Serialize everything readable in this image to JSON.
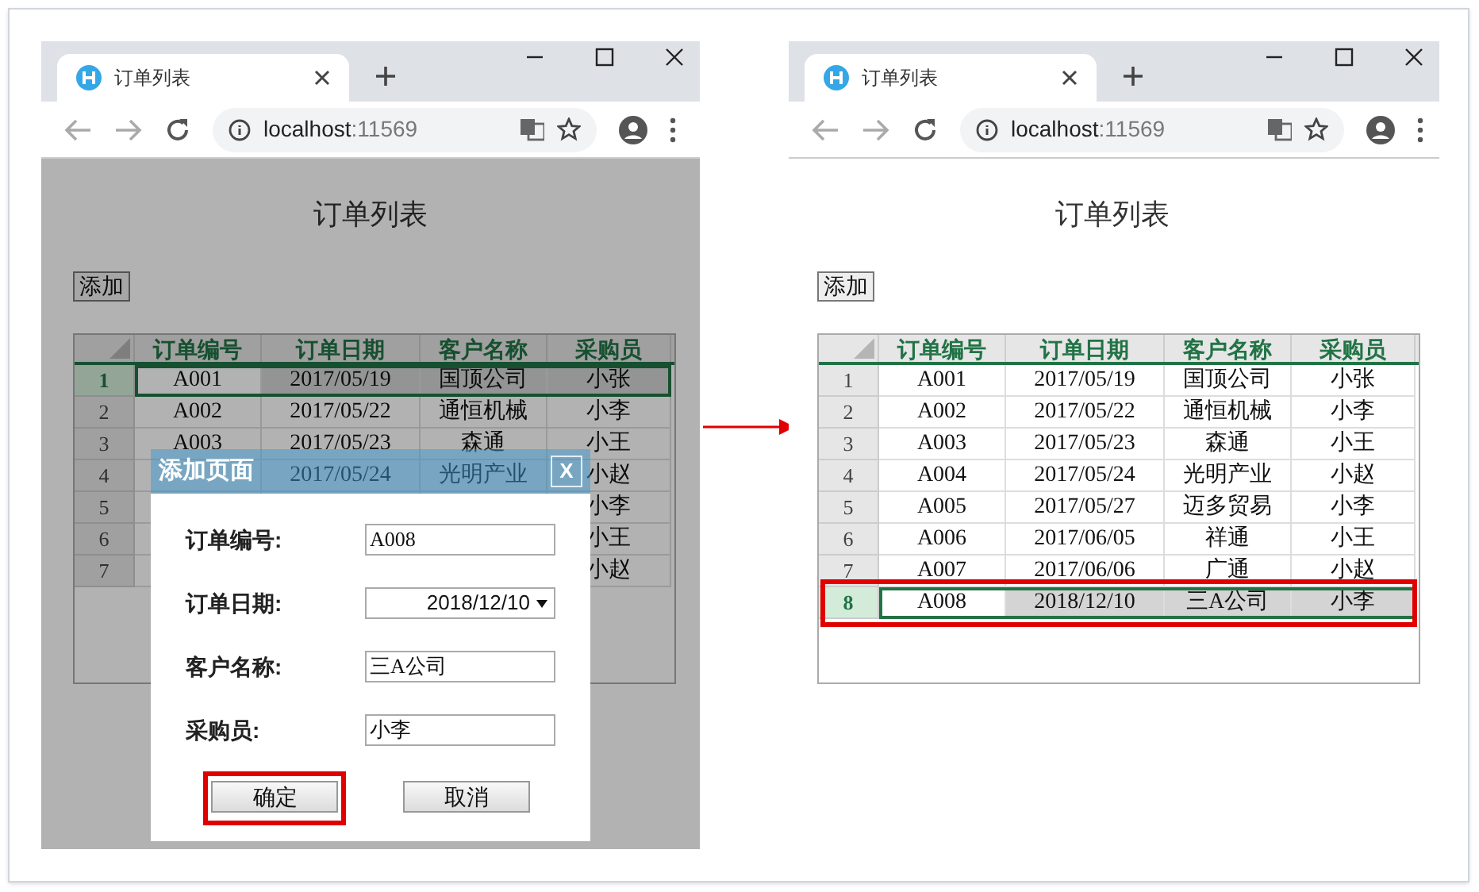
{
  "panels": [
    {
      "dimmed": true,
      "browser": {
        "tab_title": "订单列表",
        "host": "localhost",
        "port": ":11569"
      },
      "page": {
        "heading": "订单列表",
        "add_button": "添加",
        "table": {
          "columns": [
            "订单编号",
            "订单日期",
            "客户名称",
            "采购员"
          ],
          "rows": [
            {
              "number": "1",
              "selected": true,
              "annotated": false,
              "cells": [
                "A001",
                "2017/05/19",
                "国顶公司",
                "小张"
              ]
            },
            {
              "number": "2",
              "selected": false,
              "annotated": false,
              "cells": [
                "A002",
                "2017/05/22",
                "通恒机械",
                "小李"
              ]
            },
            {
              "number": "3",
              "selected": false,
              "annotated": false,
              "cells": [
                "A003",
                "2017/05/23",
                "森通",
                "小王"
              ]
            },
            {
              "number": "4",
              "selected": false,
              "annotated": false,
              "cells": [
                null,
                "2017/05/24",
                "光明产业",
                "小赵"
              ]
            },
            {
              "number": "5",
              "selected": false,
              "annotated": false,
              "cells": [
                null,
                null,
                null,
                "小李"
              ]
            },
            {
              "number": "6",
              "selected": false,
              "annotated": false,
              "cells": [
                null,
                null,
                null,
                "小王"
              ]
            },
            {
              "number": "7",
              "selected": false,
              "annotated": false,
              "cells": [
                null,
                null,
                null,
                "小赵"
              ]
            }
          ]
        }
      },
      "dialog": {
        "title": "添加页面",
        "close": "X",
        "fields": [
          {
            "kind": "text",
            "label": "订单编号:",
            "value": "A008"
          },
          {
            "kind": "select",
            "label": "订单日期:",
            "value": "2018/12/10"
          },
          {
            "kind": "text",
            "label": "客户名称:",
            "value": "三A公司"
          },
          {
            "kind": "text",
            "label": "采购员:",
            "value": "小李"
          }
        ],
        "buttons": [
          {
            "label": "确定",
            "annotated": true
          },
          {
            "label": "取消",
            "annotated": false
          }
        ]
      }
    },
    {
      "dimmed": false,
      "browser": {
        "tab_title": "订单列表",
        "host": "localhost",
        "port": ":11569"
      },
      "page": {
        "heading": "订单列表",
        "add_button": "添加",
        "table": {
          "columns": [
            "订单编号",
            "订单日期",
            "客户名称",
            "采购员"
          ],
          "rows": [
            {
              "number": "1",
              "selected": false,
              "annotated": false,
              "cells": [
                "A001",
                "2017/05/19",
                "国顶公司",
                "小张"
              ]
            },
            {
              "number": "2",
              "selected": false,
              "annotated": false,
              "cells": [
                "A002",
                "2017/05/22",
                "通恒机械",
                "小李"
              ]
            },
            {
              "number": "3",
              "selected": false,
              "annotated": false,
              "cells": [
                "A003",
                "2017/05/23",
                "森通",
                "小王"
              ]
            },
            {
              "number": "4",
              "selected": false,
              "annotated": false,
              "cells": [
                "A004",
                "2017/05/24",
                "光明产业",
                "小赵"
              ]
            },
            {
              "number": "5",
              "selected": false,
              "annotated": false,
              "cells": [
                "A005",
                "2017/05/27",
                "迈多贸易",
                "小李"
              ]
            },
            {
              "number": "6",
              "selected": false,
              "annotated": false,
              "cells": [
                "A006",
                "2017/06/05",
                "祥通",
                "小王"
              ]
            },
            {
              "number": "7",
              "selected": false,
              "annotated": false,
              "cells": [
                "A007",
                "2017/06/06",
                "广通",
                "小赵"
              ]
            },
            {
              "number": "8",
              "selected": true,
              "annotated": true,
              "cells": [
                "A008",
                "2018/12/10",
                "三A公司",
                "小李"
              ]
            }
          ]
        }
      }
    }
  ]
}
